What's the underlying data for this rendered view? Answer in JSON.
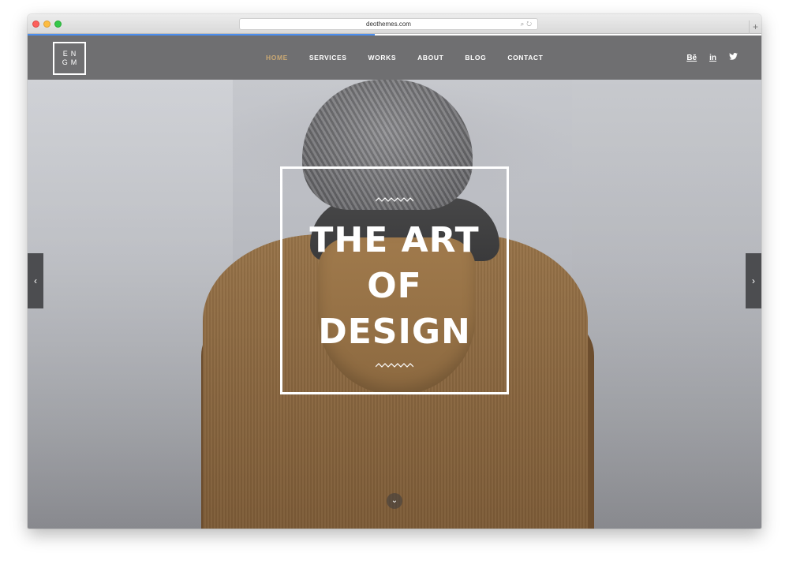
{
  "browser": {
    "url": "deothemes.com"
  },
  "site": {
    "logo_text": "ENGM",
    "nav": [
      {
        "label": "HOME",
        "active": true
      },
      {
        "label": "SERVICES",
        "active": false
      },
      {
        "label": "WORKS",
        "active": false
      },
      {
        "label": "ABOUT",
        "active": false
      },
      {
        "label": "BLOG",
        "active": false
      },
      {
        "label": "CONTACT",
        "active": false
      }
    ],
    "social": [
      "Bē",
      "in",
      "twitter"
    ],
    "accent_color": "#c9a874",
    "header_color": "#6f6f71"
  },
  "hero": {
    "title_line_1": "THE ART",
    "title_line_2": "OF",
    "title_line_3": "DESIGN",
    "left_arrow_icon": "chevron-left-icon",
    "right_arrow_icon": "chevron-right-icon",
    "scroll_icon": "chevron-down-icon"
  }
}
